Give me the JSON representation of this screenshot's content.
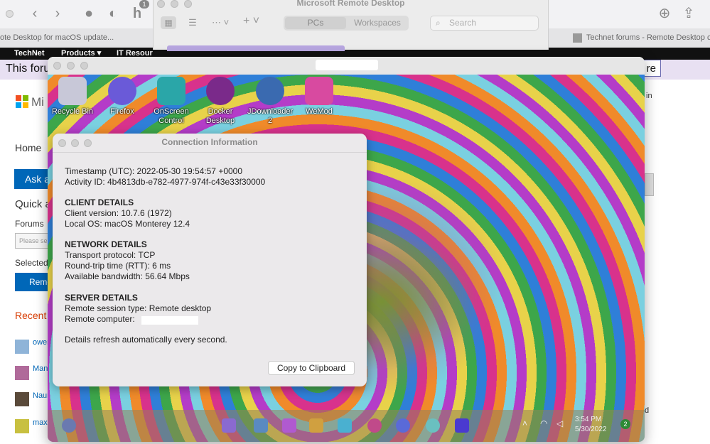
{
  "browser": {
    "tabs": [
      "ote Desktop for macOS update...",
      "Technet forums - Remote Desktop c"
    ],
    "nav": [
      "TechNet",
      "Products ▾",
      "IT Resour"
    ],
    "banner_text": "This foru",
    "banner_button_suffix": "re",
    "page_fragments": {
      "logo_text": "Mi",
      "home": "Home",
      "ask": "Ask a",
      "quick": "Quick a",
      "forums": "Forums",
      "please_select": "Please sel",
      "selected": "Selected",
      "remote_btn": "Remo",
      "recent": "Recent",
      "user1": "ower",
      "user2": "Man",
      "user3": "Naur",
      "user4": "max",
      "right_in": "in",
      "right_d": "d"
    },
    "toolbar_badge": "1"
  },
  "rd_app": {
    "title": "Microsoft Remote Desktop",
    "tabs": [
      "PCs",
      "Workspaces"
    ],
    "search_placeholder": "Search"
  },
  "desktop": {
    "icons": [
      {
        "label": "Recycle Bin",
        "color": "#c8c8d8"
      },
      {
        "label": "Firefox",
        "color": "#6a5ad8"
      },
      {
        "label": "OnScreen Control",
        "color": "#2aa6a8"
      },
      {
        "label": "Docker Desktop",
        "color": "#7a2a8a"
      },
      {
        "label": "JDownloader 2",
        "color": "#3a6ab0"
      },
      {
        "label": "WeMod",
        "color": "#d84aa0"
      }
    ],
    "clock_time": "3:54 PM",
    "clock_date": "5/30/2022",
    "notification_count": "2"
  },
  "connection_info": {
    "title": "Connection Information",
    "timestamp": "Timestamp (UTC): 2022-05-30 19:54:57 +0000",
    "activity_id": "Activity ID: 4b4813db-e782-4977-974f-c43e33f30000",
    "client_header": "CLIENT DETAILS",
    "client_version": "Client version: 10.7.6 (1972)",
    "local_os": "Local OS: macOS Monterey 12.4",
    "network_header": "NETWORK DETAILS",
    "transport": "Transport protocol: TCP",
    "rtt": "Round-trip time (RTT): 6 ms",
    "bandwidth": "Available bandwidth: 56.64 Mbps",
    "server_header": "SERVER DETAILS",
    "session_type": "Remote session type: Remote desktop",
    "remote_computer": "Remote computer:",
    "refresh_note": "Details refresh automatically every second.",
    "copy_button": "Copy to Clipboard"
  }
}
